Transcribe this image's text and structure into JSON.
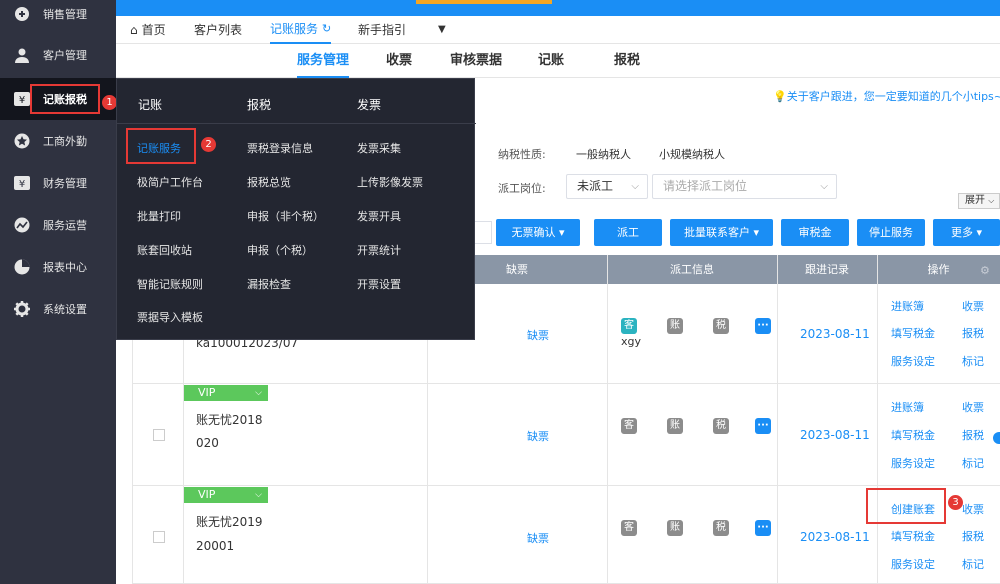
{
  "sidebar": {
    "items": [
      {
        "label": "销售管理",
        "icon": "sales-icon"
      },
      {
        "label": "客户管理",
        "icon": "user-icon"
      },
      {
        "label": "记账报税",
        "icon": "yen-icon"
      },
      {
        "label": "工商外勤",
        "icon": "star-icon"
      },
      {
        "label": "财务管理",
        "icon": "finance-icon"
      },
      {
        "label": "服务运营",
        "icon": "chart-line-icon"
      },
      {
        "label": "报表中心",
        "icon": "pie-icon"
      },
      {
        "label": "系统设置",
        "icon": "gear-icon"
      }
    ],
    "badge": "1"
  },
  "tabs": {
    "home": "首页",
    "items": [
      "客户列表",
      "记账服务",
      "新手指引"
    ]
  },
  "subnav": [
    "服务管理",
    "收票",
    "审核票据",
    "记账",
    "报税"
  ],
  "tips": "关于客户跟进，您一定要知道的几个小tips~",
  "filters": {
    "tax_label": "纳税性质:",
    "tax_opts": [
      "一般纳税人",
      "小规模纳税人"
    ],
    "post_label": "派工岗位:",
    "post_value": "未派工",
    "post_placeholder": "请选择派工岗位",
    "expand": "展开"
  },
  "buttons": [
    "无票确认",
    "派工",
    "批量联系客户",
    "审税金",
    "停止服务",
    "更多"
  ],
  "table": {
    "headers": [
      "缺票",
      "派工信息",
      "跟进记录",
      "操作"
    ],
    "rows": [
      {
        "vip": "",
        "name1": "",
        "name2": "ka100012023/07",
        "missing": "缺票",
        "pill_name": "xgy",
        "date": "2023-08-11",
        "actions": [
          "进账簿",
          "收票",
          "填写税金",
          "报税",
          "服务设定",
          "标记"
        ]
      },
      {
        "vip": "VIP",
        "name1": "账无忧2018",
        "name2": "020",
        "missing": "缺票",
        "pill_name": "",
        "date": "2023-08-11",
        "actions": [
          "进账簿",
          "收票",
          "填写税金",
          "报税",
          "服务设定",
          "标记"
        ]
      },
      {
        "vip": "VIP",
        "name1": "账无忧2019",
        "name2": "20001",
        "missing": "缺票",
        "pill_name": "",
        "date": "2023-08-11",
        "actions": [
          "创建账套",
          "收票",
          "填写税金",
          "报税",
          "服务设定",
          "标记"
        ]
      }
    ],
    "pills": [
      "客",
      "账",
      "税",
      "···"
    ]
  },
  "menu": {
    "headers": [
      "记账",
      "报税",
      "发票"
    ],
    "col1": [
      "记账服务",
      "极简户工作台",
      "批量打印",
      "账套回收站",
      "智能记账规则",
      "票据导入模板"
    ],
    "col2": [
      "票税登录信息",
      "报税总览",
      "申报（非个税）",
      "申报（个税）",
      "漏报检查"
    ],
    "col3": [
      "发票采集",
      "上传影像发票",
      "发票开具",
      "开票统计",
      "开票设置"
    ]
  },
  "badges": [
    "1",
    "2",
    "3"
  ]
}
